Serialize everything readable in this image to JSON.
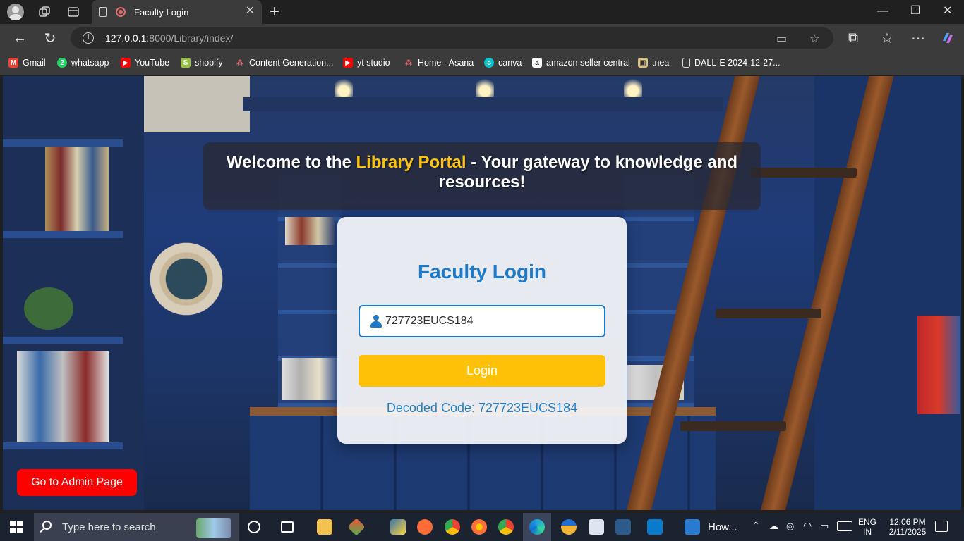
{
  "browser": {
    "tab_title": "Faculty Login",
    "url_host": "127.0.0.1",
    "url_rest": ":8000/Library/index/",
    "bookmarks": [
      {
        "label": "Gmail",
        "icon": "gmail-icon",
        "color": "#ea4335"
      },
      {
        "label": "whatsapp",
        "icon": "whatsapp-icon",
        "color": "#25d366"
      },
      {
        "label": "YouTube",
        "icon": "youtube-icon",
        "color": "#ff0000"
      },
      {
        "label": "shopify",
        "icon": "shopify-icon",
        "color": "#95bf47"
      },
      {
        "label": "Content Generation...",
        "icon": "asana-icon",
        "color": "#f06a6a"
      },
      {
        "label": "yt studio",
        "icon": "youtube-icon",
        "color": "#ff0000"
      },
      {
        "label": "Home - Asana",
        "icon": "asana-icon",
        "color": "#f06a6a"
      },
      {
        "label": "canva",
        "icon": "canva-icon",
        "color": "#00c4cc"
      },
      {
        "label": "amazon seller central",
        "icon": "amazon-icon",
        "color": "#232f3e"
      },
      {
        "label": "tnea",
        "icon": "tnea-icon",
        "color": "#d9c28a"
      },
      {
        "label": "DALL·E 2024-12-27...",
        "icon": "document-icon",
        "color": "#3b3b3b"
      }
    ]
  },
  "page": {
    "welcome_prefix": "Welcome to the ",
    "welcome_highlight": "Library Portal",
    "welcome_suffix": " - Your gateway to knowledge and resources!",
    "heading": "Faculty Login",
    "input_value": "727723EUCS184",
    "login_label": "Login",
    "decoded_text": "Decoded Code: 727723EUCS184",
    "admin_label": "Go to Admin Page",
    "colors": {
      "accent_blue": "#1c7ac8",
      "highlight_yellow": "#ffc20e",
      "login_button": "#ffc107",
      "admin_button": "#ff0000"
    }
  },
  "taskbar": {
    "search_placeholder": "Type here to search",
    "app_label": "How...",
    "lang_line1": "ENG",
    "lang_line2": "IN",
    "time": "12:06 PM",
    "date": "2/11/2025"
  }
}
